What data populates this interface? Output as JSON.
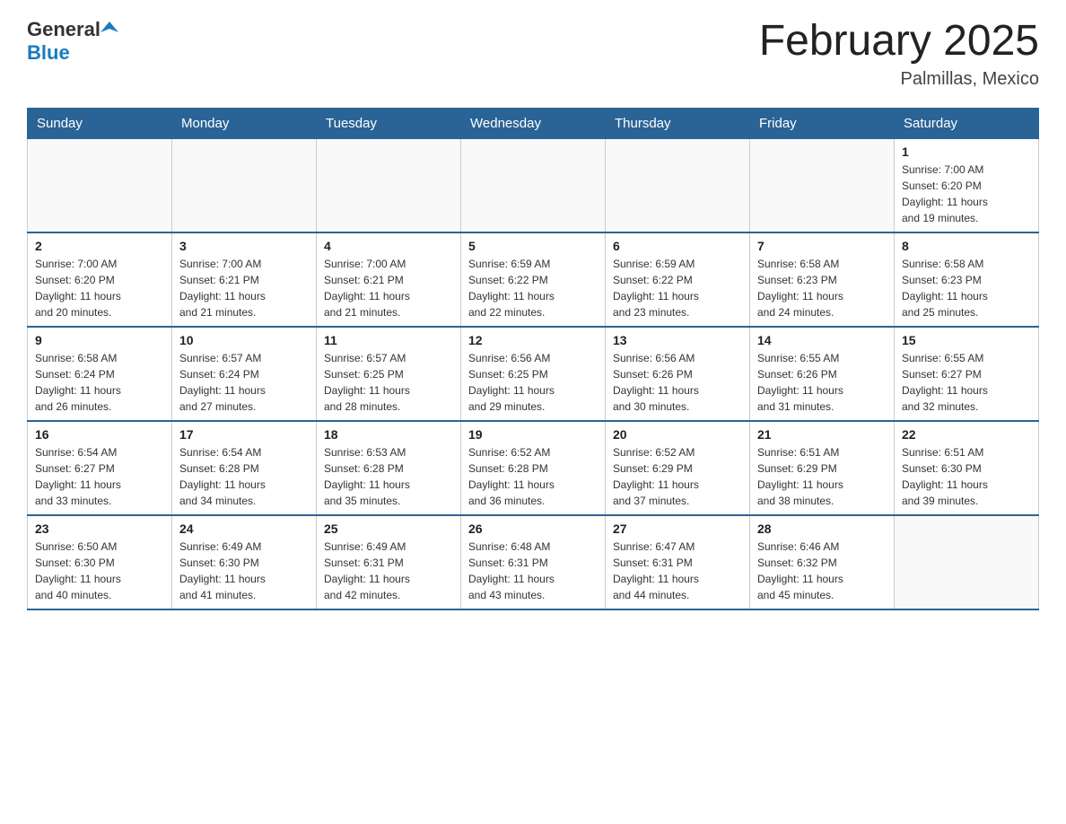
{
  "header": {
    "logo": {
      "general": "General",
      "blue": "Blue"
    },
    "title": "February 2025",
    "location": "Palmillas, Mexico"
  },
  "calendar": {
    "days_of_week": [
      "Sunday",
      "Monday",
      "Tuesday",
      "Wednesday",
      "Thursday",
      "Friday",
      "Saturday"
    ],
    "weeks": [
      [
        {
          "day": "",
          "info": ""
        },
        {
          "day": "",
          "info": ""
        },
        {
          "day": "",
          "info": ""
        },
        {
          "day": "",
          "info": ""
        },
        {
          "day": "",
          "info": ""
        },
        {
          "day": "",
          "info": ""
        },
        {
          "day": "1",
          "info": "Sunrise: 7:00 AM\nSunset: 6:20 PM\nDaylight: 11 hours\nand 19 minutes."
        }
      ],
      [
        {
          "day": "2",
          "info": "Sunrise: 7:00 AM\nSunset: 6:20 PM\nDaylight: 11 hours\nand 20 minutes."
        },
        {
          "day": "3",
          "info": "Sunrise: 7:00 AM\nSunset: 6:21 PM\nDaylight: 11 hours\nand 21 minutes."
        },
        {
          "day": "4",
          "info": "Sunrise: 7:00 AM\nSunset: 6:21 PM\nDaylight: 11 hours\nand 21 minutes."
        },
        {
          "day": "5",
          "info": "Sunrise: 6:59 AM\nSunset: 6:22 PM\nDaylight: 11 hours\nand 22 minutes."
        },
        {
          "day": "6",
          "info": "Sunrise: 6:59 AM\nSunset: 6:22 PM\nDaylight: 11 hours\nand 23 minutes."
        },
        {
          "day": "7",
          "info": "Sunrise: 6:58 AM\nSunset: 6:23 PM\nDaylight: 11 hours\nand 24 minutes."
        },
        {
          "day": "8",
          "info": "Sunrise: 6:58 AM\nSunset: 6:23 PM\nDaylight: 11 hours\nand 25 minutes."
        }
      ],
      [
        {
          "day": "9",
          "info": "Sunrise: 6:58 AM\nSunset: 6:24 PM\nDaylight: 11 hours\nand 26 minutes."
        },
        {
          "day": "10",
          "info": "Sunrise: 6:57 AM\nSunset: 6:24 PM\nDaylight: 11 hours\nand 27 minutes."
        },
        {
          "day": "11",
          "info": "Sunrise: 6:57 AM\nSunset: 6:25 PM\nDaylight: 11 hours\nand 28 minutes."
        },
        {
          "day": "12",
          "info": "Sunrise: 6:56 AM\nSunset: 6:25 PM\nDaylight: 11 hours\nand 29 minutes."
        },
        {
          "day": "13",
          "info": "Sunrise: 6:56 AM\nSunset: 6:26 PM\nDaylight: 11 hours\nand 30 minutes."
        },
        {
          "day": "14",
          "info": "Sunrise: 6:55 AM\nSunset: 6:26 PM\nDaylight: 11 hours\nand 31 minutes."
        },
        {
          "day": "15",
          "info": "Sunrise: 6:55 AM\nSunset: 6:27 PM\nDaylight: 11 hours\nand 32 minutes."
        }
      ],
      [
        {
          "day": "16",
          "info": "Sunrise: 6:54 AM\nSunset: 6:27 PM\nDaylight: 11 hours\nand 33 minutes."
        },
        {
          "day": "17",
          "info": "Sunrise: 6:54 AM\nSunset: 6:28 PM\nDaylight: 11 hours\nand 34 minutes."
        },
        {
          "day": "18",
          "info": "Sunrise: 6:53 AM\nSunset: 6:28 PM\nDaylight: 11 hours\nand 35 minutes."
        },
        {
          "day": "19",
          "info": "Sunrise: 6:52 AM\nSunset: 6:28 PM\nDaylight: 11 hours\nand 36 minutes."
        },
        {
          "day": "20",
          "info": "Sunrise: 6:52 AM\nSunset: 6:29 PM\nDaylight: 11 hours\nand 37 minutes."
        },
        {
          "day": "21",
          "info": "Sunrise: 6:51 AM\nSunset: 6:29 PM\nDaylight: 11 hours\nand 38 minutes."
        },
        {
          "day": "22",
          "info": "Sunrise: 6:51 AM\nSunset: 6:30 PM\nDaylight: 11 hours\nand 39 minutes."
        }
      ],
      [
        {
          "day": "23",
          "info": "Sunrise: 6:50 AM\nSunset: 6:30 PM\nDaylight: 11 hours\nand 40 minutes."
        },
        {
          "day": "24",
          "info": "Sunrise: 6:49 AM\nSunset: 6:30 PM\nDaylight: 11 hours\nand 41 minutes."
        },
        {
          "day": "25",
          "info": "Sunrise: 6:49 AM\nSunset: 6:31 PM\nDaylight: 11 hours\nand 42 minutes."
        },
        {
          "day": "26",
          "info": "Sunrise: 6:48 AM\nSunset: 6:31 PM\nDaylight: 11 hours\nand 43 minutes."
        },
        {
          "day": "27",
          "info": "Sunrise: 6:47 AM\nSunset: 6:31 PM\nDaylight: 11 hours\nand 44 minutes."
        },
        {
          "day": "28",
          "info": "Sunrise: 6:46 AM\nSunset: 6:32 PM\nDaylight: 11 hours\nand 45 minutes."
        },
        {
          "day": "",
          "info": ""
        }
      ]
    ]
  }
}
